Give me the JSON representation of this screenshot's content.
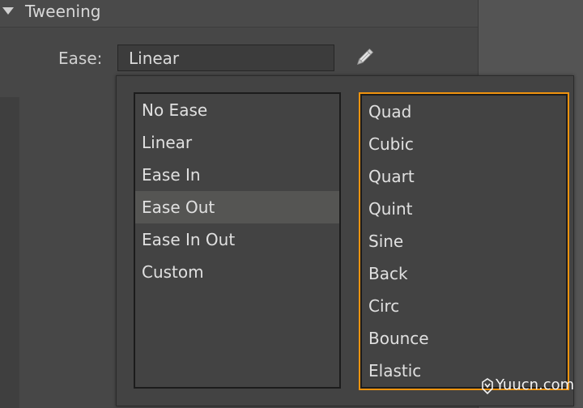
{
  "panel": {
    "title": "Tweening"
  },
  "ease": {
    "label": "Ease:",
    "selected_value": "Linear"
  },
  "dropdown": {
    "left_items": [
      {
        "label": "No Ease"
      },
      {
        "label": "Linear"
      },
      {
        "label": "Ease In"
      },
      {
        "label": "Ease Out",
        "selected": true
      },
      {
        "label": "Ease In Out"
      },
      {
        "label": "Custom"
      }
    ],
    "right_items": [
      {
        "label": "Quad"
      },
      {
        "label": "Cubic"
      },
      {
        "label": "Quart"
      },
      {
        "label": "Quint"
      },
      {
        "label": "Sine"
      },
      {
        "label": "Back"
      },
      {
        "label": "Circ"
      },
      {
        "label": "Bounce"
      },
      {
        "label": "Elastic"
      }
    ]
  },
  "watermark": {
    "text": "Yuucn.com"
  },
  "colors": {
    "accent": "#f0930e",
    "panel_bg": "#474747",
    "list_bg": "#434343",
    "selected_row": "#555553"
  },
  "icons": {
    "collapse": "triangle-down-icon",
    "edit": "pencil-icon",
    "brand": "logo-icon"
  }
}
